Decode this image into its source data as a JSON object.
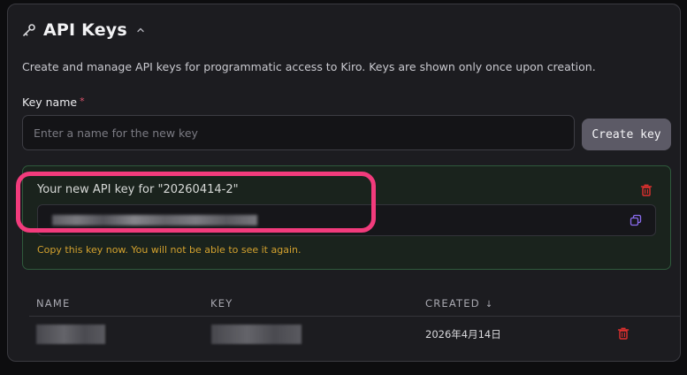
{
  "header": {
    "title": "API Keys",
    "icon": "key-icon",
    "toggle_icon": "chevron-up-icon"
  },
  "description": "Create and manage API keys for programmatic access to Kiro. Keys are shown only once upon creation.",
  "form": {
    "label": "Key name",
    "required_marker": "*",
    "placeholder": "Enter a name for the new key",
    "value": "",
    "create_label": "Create key"
  },
  "new_key": {
    "title": "Your new API key for \"20260414-2\"",
    "warning": "Copy this key now. You will not be able to see it again.",
    "copy_icon": "copy-icon",
    "delete_icon": "trash-icon"
  },
  "table": {
    "headers": {
      "name": "NAME",
      "key": "KEY",
      "created": "CREATED"
    },
    "sort_indicator": "↓",
    "rows": [
      {
        "created": "2026年4月14日"
      }
    ]
  },
  "colors": {
    "accent_delete": "#e0302f",
    "warning": "#d3a12e",
    "success_border": "#2f5a3c",
    "highlight": "#f23b7c",
    "copy_icon": "#8b6cf0"
  }
}
